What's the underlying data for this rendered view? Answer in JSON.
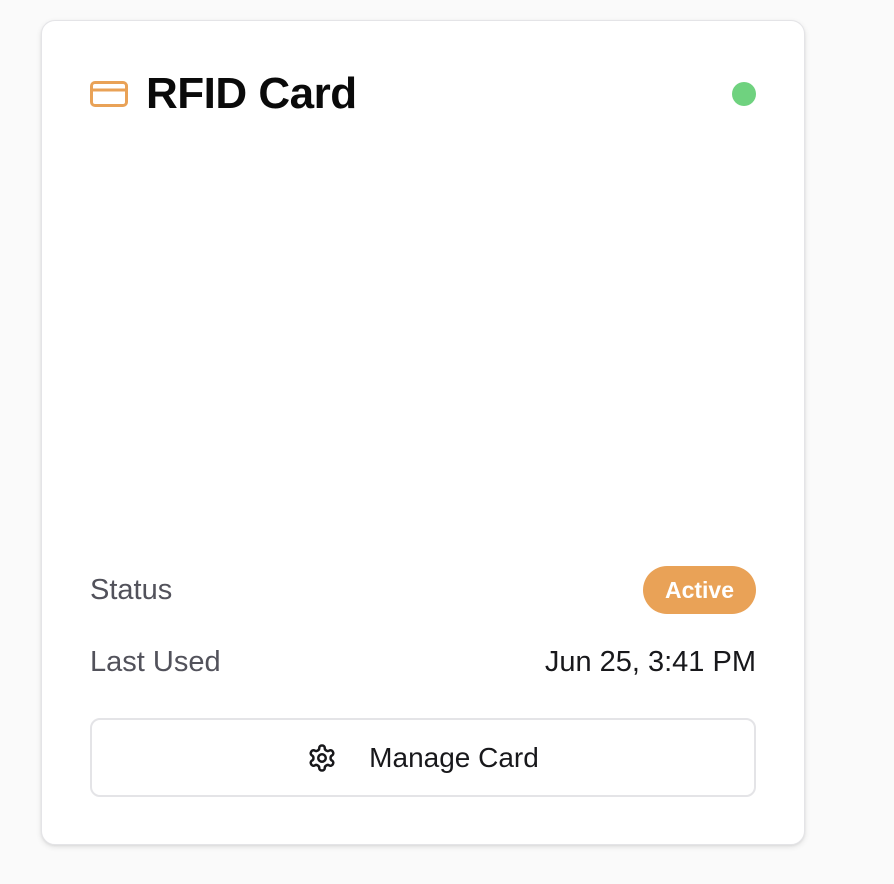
{
  "card": {
    "title": "RFID Card",
    "icon": "credit-card-icon",
    "status_dot_color": "#6fd27f",
    "status": {
      "label": "Status",
      "value": "Active",
      "badge_color": "#e9a257"
    },
    "last_used": {
      "label": "Last Used",
      "value": "Jun 25, 3:41 PM"
    },
    "manage_button": {
      "label": "Manage Card",
      "icon": "gear-icon"
    },
    "accent_color": "#e9a257"
  }
}
